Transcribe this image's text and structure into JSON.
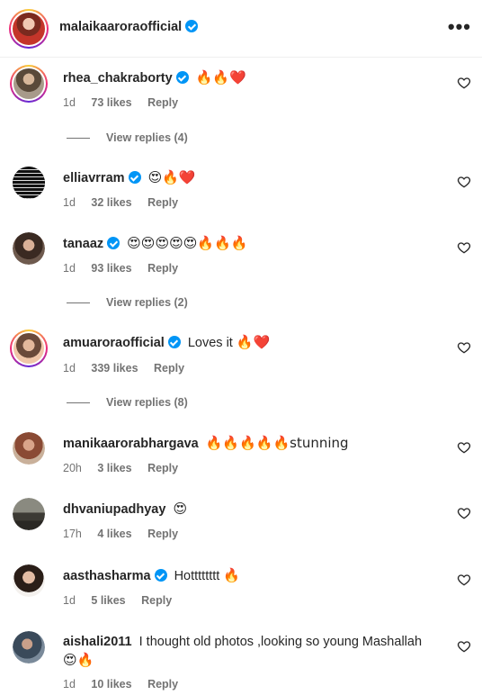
{
  "post_header": {
    "username": "malaikaaroraofficial",
    "verified": true,
    "more_label": "•••"
  },
  "icons": {
    "like": "heart-outline-icon",
    "verified": "verified-badge-icon",
    "more": "more-options-icon"
  },
  "colors": {
    "verified_blue": "#0095f6",
    "meta_gray": "#737373",
    "text": "#262626"
  },
  "comments": [
    {
      "username": "rhea_chakraborty",
      "verified": true,
      "text": "",
      "emoji": "🔥🔥❤️",
      "time": "1d",
      "likes": "73 likes",
      "reply": "Reply",
      "view_replies": "View replies (4)"
    },
    {
      "username": "elliavrram",
      "verified": true,
      "text": "",
      "emoji": "😍🔥❤️",
      "time": "1d",
      "likes": "32 likes",
      "reply": "Reply"
    },
    {
      "username": "tanaaz",
      "verified": true,
      "text": "",
      "emoji": "😍😍😍😍😍🔥🔥🔥",
      "time": "1d",
      "likes": "93 likes",
      "reply": "Reply",
      "view_replies": "View replies (2)"
    },
    {
      "username": "amuaroraofficial",
      "verified": true,
      "text": "Loves it",
      "emoji": "🔥❤️",
      "time": "1d",
      "likes": "339 likes",
      "reply": "Reply",
      "view_replies": "View replies (8)"
    },
    {
      "username": "manikaarorabhargava",
      "verified": false,
      "text": "🔥🔥🔥🔥🔥stunning",
      "emoji": "",
      "time": "20h",
      "likes": "3 likes",
      "reply": "Reply"
    },
    {
      "username": "dhvaniupadhyay",
      "verified": false,
      "text": "",
      "emoji": "😍",
      "time": "17h",
      "likes": "4 likes",
      "reply": "Reply"
    },
    {
      "username": "aasthasharma",
      "verified": true,
      "text": "Hotttttttt",
      "emoji": "🔥",
      "time": "1d",
      "likes": "5 likes",
      "reply": "Reply"
    },
    {
      "username": "aishali2011",
      "verified": false,
      "text": "I thought old photos ,looking so young Mashallah",
      "emoji": "😍🔥",
      "time": "1d",
      "likes": "10 likes",
      "reply": "Reply"
    }
  ]
}
